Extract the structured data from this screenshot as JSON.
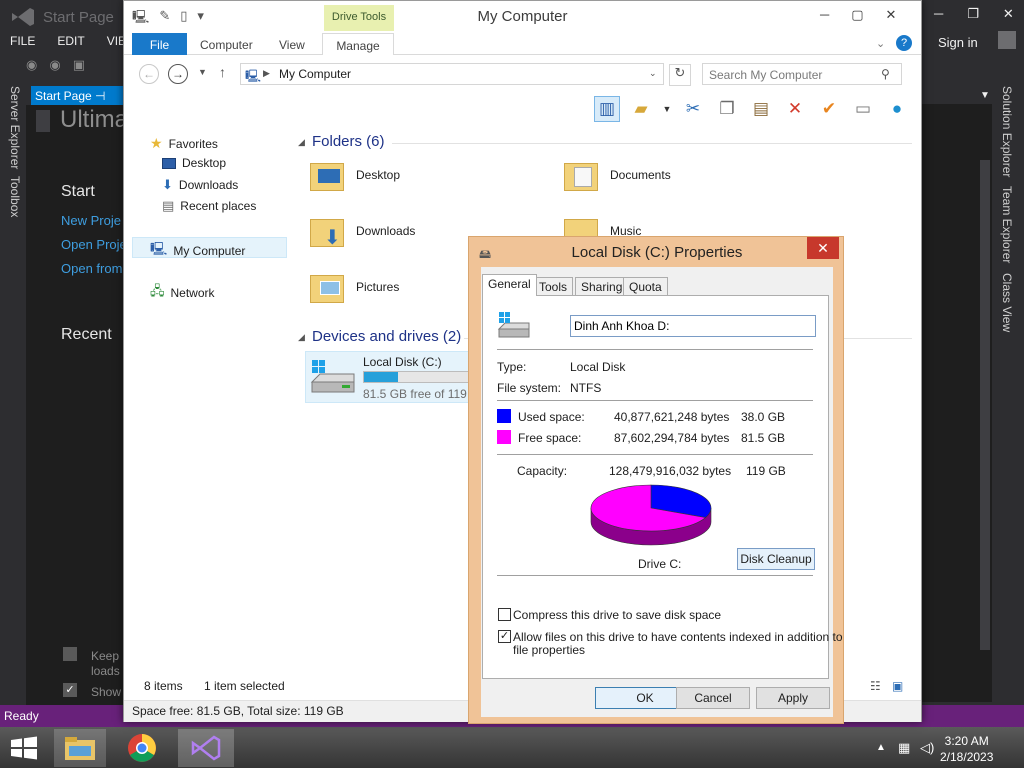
{
  "vs": {
    "title": "Start Page",
    "menu": [
      "FILE",
      "EDIT",
      "VIEW"
    ],
    "doc_tab": "Start Page",
    "heading": "Ultima",
    "start_label": "Start",
    "links": [
      "New Proje",
      "Open Proje",
      "Open from"
    ],
    "recent_label": "Recent",
    "left_panels": [
      "Server Explorer",
      "Toolbox"
    ],
    "right_panels": [
      "Solution Explorer",
      "Team Explorer",
      "Class View"
    ],
    "sign_in": "Sign in",
    "keep_label": "Keep p",
    "loads_label": "loads",
    "show_label": "Show",
    "status": "Ready"
  },
  "taskbar": {
    "time": "3:20 AM",
    "date": "2/18/2023"
  },
  "explorer": {
    "title": "My Computer",
    "context_tab": "Drive Tools",
    "tabs": [
      "File",
      "Computer",
      "View",
      "Manage"
    ],
    "address": "My Computer",
    "search_placeholder": "Search My Computer",
    "nav": {
      "favorites": "Favorites",
      "desktop": "Desktop",
      "downloads": "Downloads",
      "recent_places": "Recent places",
      "my_computer": "My Computer",
      "network": "Network"
    },
    "folders_header": "Folders (6)",
    "folders": [
      "Desktop",
      "Documents",
      "Downloads",
      "Music",
      "Pictures"
    ],
    "devices_header": "Devices and drives (2)",
    "drive": {
      "name": "Local Disk (C:)",
      "free_text": "81.5 GB free of 119 GB",
      "used_fraction": 0.315
    },
    "status_items": "8 items",
    "status_selected": "1 item selected",
    "status_space": "Space free: 81.5 GB, Total size: 119 GB"
  },
  "dialog": {
    "title": "Local Disk (C:) Properties",
    "tabs": [
      "General",
      "Tools",
      "Sharing",
      "Quota"
    ],
    "label_value": "Dinh Anh Khoa D:",
    "type_label": "Type:",
    "type_value": "Local Disk",
    "fs_label": "File system:",
    "fs_value": "NTFS",
    "used_label": "Used space:",
    "used_bytes": "40,877,621,248 bytes",
    "used_gb": "38.0 GB",
    "free_label": "Free space:",
    "free_bytes": "87,602,294,784 bytes",
    "free_gb": "81.5 GB",
    "capacity_label": "Capacity:",
    "capacity_bytes": "128,479,916,032 bytes",
    "capacity_gb": "119 GB",
    "drive_label": "Drive C:",
    "cleanup_button": "Disk Cleanup",
    "compress_label": "Compress this drive to save disk space",
    "index_label": "Allow files on this drive to have contents indexed in addition to",
    "index_label2": "file properties",
    "compress_checked": false,
    "index_checked": true,
    "ok": "OK",
    "cancel": "Cancel",
    "apply": "Apply",
    "used_color": "#0000ff",
    "free_color": "#ff00ff"
  },
  "chart_data": {
    "type": "pie",
    "categories": [
      "Used space",
      "Free space"
    ],
    "values": [
      38.0,
      81.5
    ],
    "title": "Drive C:",
    "colors": [
      "#0000ff",
      "#ff00ff"
    ]
  }
}
